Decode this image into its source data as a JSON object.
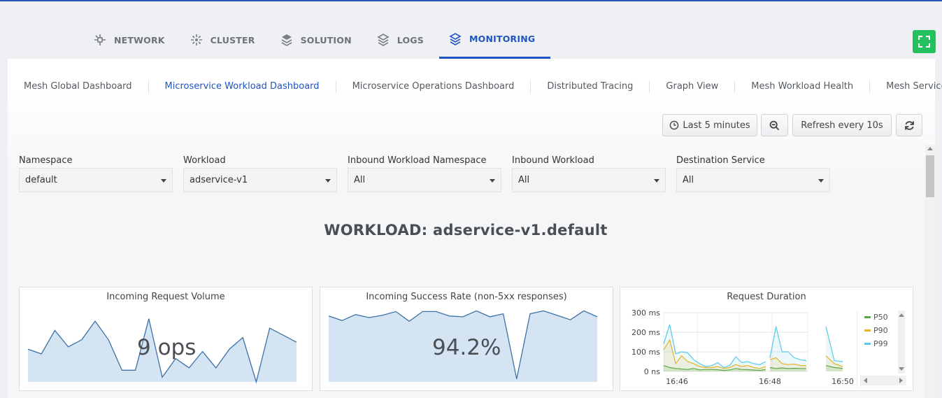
{
  "top_tabs": [
    {
      "label": "NETWORK",
      "icon": "network-icon"
    },
    {
      "label": "CLUSTER",
      "icon": "cluster-icon"
    },
    {
      "label": "SOLUTION",
      "icon": "solution-icon"
    },
    {
      "label": "LOGS",
      "icon": "logs-icon"
    },
    {
      "label": "MONITORING",
      "icon": "monitoring-icon",
      "active": true
    }
  ],
  "sub_tabs": [
    {
      "label": "Mesh Global Dashboard"
    },
    {
      "label": "Microservice Workload Dashboard",
      "active": true
    },
    {
      "label": "Microservice Operations Dashboard"
    },
    {
      "label": "Distributed Tracing"
    },
    {
      "label": "Graph View"
    },
    {
      "label": "Mesh Workload Health"
    },
    {
      "label": "Mesh Service Health"
    }
  ],
  "toolbar": {
    "time_range_label": "Last 5 minutes",
    "refresh_label": "Refresh every 10s"
  },
  "filters": [
    {
      "label": "Namespace",
      "value": "default"
    },
    {
      "label": "Workload",
      "value": "adservice-v1"
    },
    {
      "label": "Inbound Workload Namespace",
      "value": "All"
    },
    {
      "label": "Inbound Workload",
      "value": "All"
    },
    {
      "label": "Destination Service",
      "value": "All"
    }
  ],
  "workload_title": "WORKLOAD: adservice-v1.default",
  "cards": {
    "volume": {
      "title": "Incoming Request Volume",
      "value": "9 ops"
    },
    "success": {
      "title": "Incoming Success Rate (non-5xx responses)",
      "value": "94.2%"
    },
    "duration": {
      "title": "Request Duration"
    }
  },
  "colors": {
    "accent": "#1f55c0",
    "fullscreen": "#22c15e",
    "sparkline_fill": "#d4e4f2",
    "sparkline_line": "#3c72a8",
    "p50": "#5aa845",
    "p90": "#e6b325",
    "p99": "#5bc8e8"
  },
  "chart_data": [
    {
      "type": "area",
      "title": "Incoming Request Volume",
      "ylim": [
        0,
        16
      ],
      "values": [
        7,
        6,
        11,
        7.5,
        9,
        13,
        9,
        2.5,
        2.5,
        13.5,
        1,
        5,
        3,
        6.5,
        3,
        7,
        9.5,
        0,
        11.5,
        10,
        8.5
      ]
    },
    {
      "type": "area",
      "title": "Incoming Success Rate (non-5xx responses)",
      "ylim": [
        0,
        100
      ],
      "values": [
        88,
        82,
        90,
        86,
        89,
        94,
        81,
        94,
        94,
        88,
        87,
        95,
        87,
        91,
        4,
        91,
        95,
        89,
        83,
        95,
        87
      ]
    },
    {
      "type": "line",
      "title": "Request Duration",
      "ylim": [
        0,
        300
      ],
      "y_ticks": [
        "300 ms",
        "200 ms",
        "100 ms",
        "0 ns"
      ],
      "x_ticks": [
        "16:46",
        "16:48",
        "16:50"
      ],
      "series": [
        {
          "name": "P50",
          "segments": [
            [
              30,
              20,
              15,
              12,
              10,
              15,
              8,
              10,
              10,
              9,
              5,
              8,
              15,
              10,
              9,
              7,
              5,
              10
            ],
            [
              20,
              15,
              18,
              15,
              16,
              15,
              15
            ],
            [
              30,
              20,
              15
            ]
          ]
        },
        {
          "name": "P90",
          "segments": [
            [
              110,
              160,
              40,
              80,
              50,
              40,
              25,
              20,
              20,
              25,
              15,
              20,
              35,
              25,
              30,
              20,
              15,
              25
            ],
            [
              60,
              70,
              40,
              35,
              38,
              30,
              30
            ],
            [
              80,
              40,
              25
            ]
          ]
        },
        {
          "name": "P99",
          "segments": [
            [
              140,
              240,
              90,
              100,
              95,
              60,
              40,
              25,
              30,
              45,
              20,
              30,
              75,
              45,
              50,
              40,
              35,
              50
            ],
            [
              70,
              230,
              100,
              100,
              70,
              60,
              55
            ],
            [
              230,
              55,
              50
            ]
          ]
        }
      ]
    }
  ]
}
